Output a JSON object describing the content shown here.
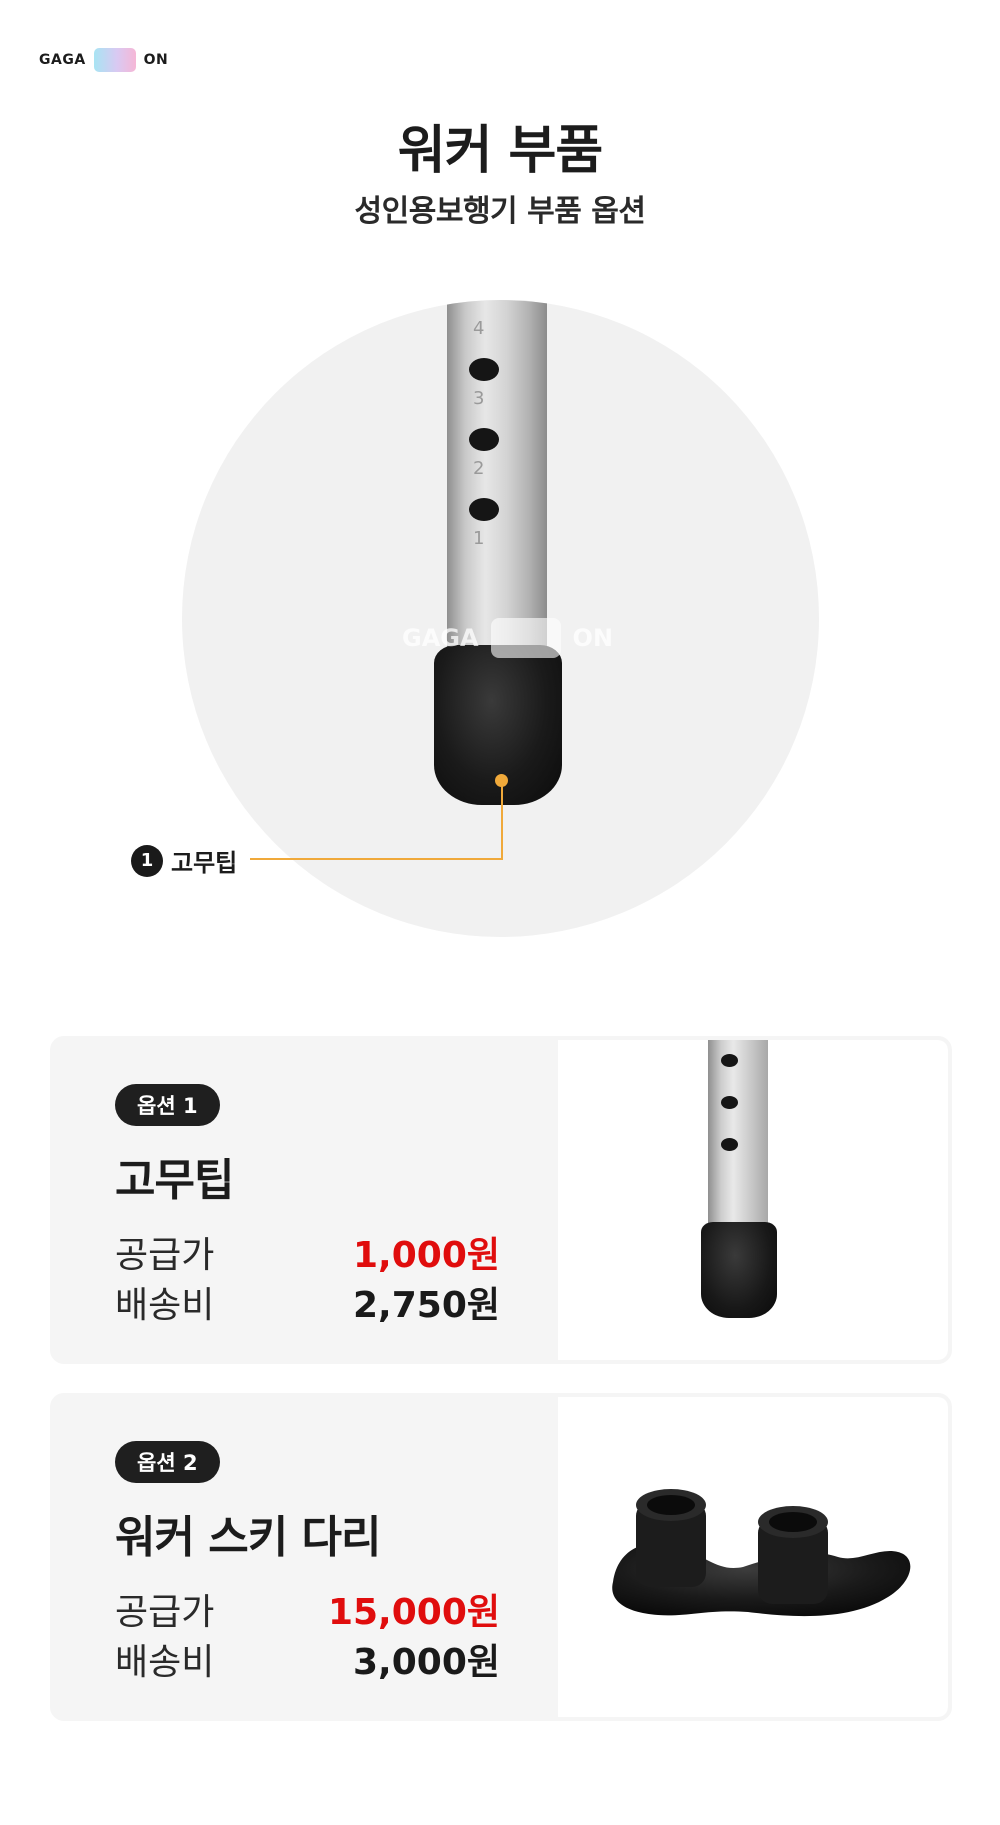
{
  "brand": {
    "left": "GAGA",
    "right": "ON"
  },
  "header": {
    "title": "워커 부품",
    "subtitle": "성인용보행기 부품 옵션"
  },
  "hero": {
    "tube_numbers": [
      "4",
      "3",
      "2",
      "1"
    ],
    "watermark": {
      "left": "GAGA",
      "right": "ON"
    },
    "callout": {
      "number": "1",
      "label": "고무팁"
    },
    "accent_color": "#f0a93a"
  },
  "options": [
    {
      "badge": "옵션 1",
      "name": "고무팁",
      "supply_label": "공급가",
      "supply_price": "1,000원",
      "shipping_label": "배송비",
      "shipping_price": "2,750원"
    },
    {
      "badge": "옵션 2",
      "name": "워커 스키 다리",
      "supply_label": "공급가",
      "supply_price": "15,000원",
      "shipping_label": "배송비",
      "shipping_price": "3,000원"
    }
  ],
  "colors": {
    "price_red": "#e00d0d",
    "badge_dark": "#1f1f1f"
  }
}
